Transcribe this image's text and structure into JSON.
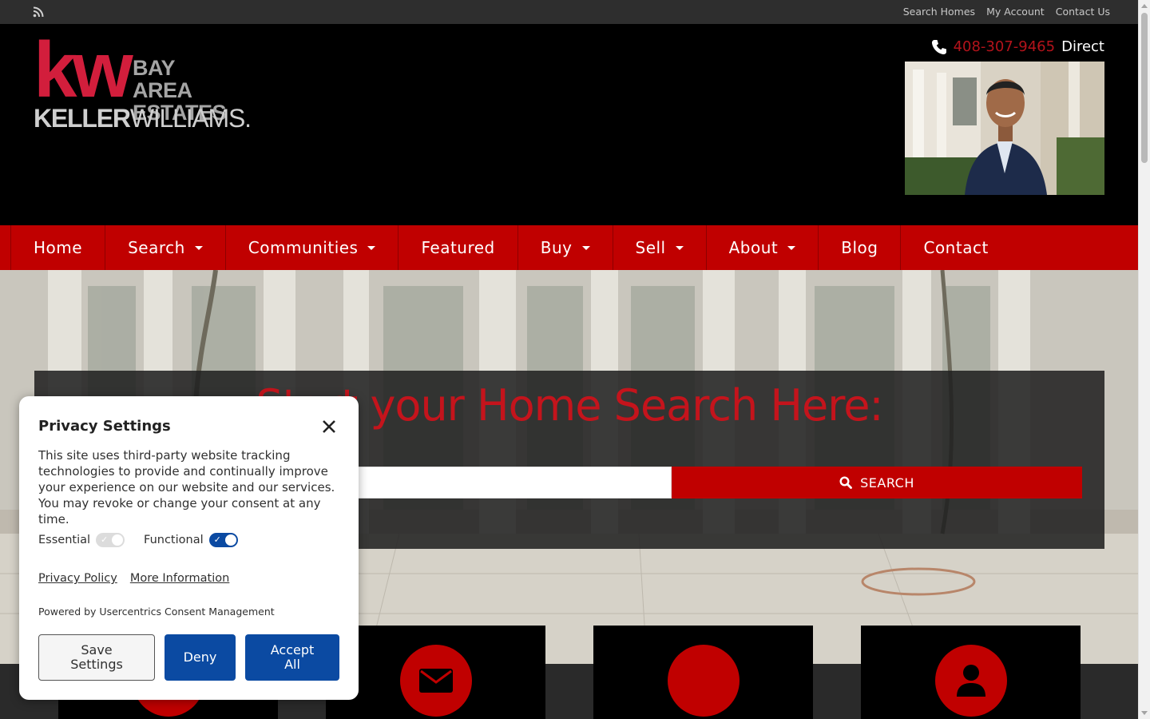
{
  "topbar": {
    "rss_icon": "rss-icon",
    "links": [
      "Search Homes",
      "My Account",
      "Contact Us"
    ]
  },
  "header": {
    "logo": {
      "kw": "kw",
      "line1": "BAY AREA",
      "line2": "ESTATES",
      "brand_bold": "KELLER",
      "brand_light": "WILLIAMS."
    },
    "phone": {
      "number": "408-307-9465",
      "label": "Direct"
    }
  },
  "nav": {
    "items": [
      {
        "label": "Home"
      },
      {
        "label": "Search"
      },
      {
        "label": "Communities"
      },
      {
        "label": "Featured"
      },
      {
        "label": "Buy"
      },
      {
        "label": "Sell"
      },
      {
        "label": "About"
      },
      {
        "label": "Blog"
      },
      {
        "label": "Contact"
      }
    ]
  },
  "hero": {
    "title": "Start your Home Search Here:",
    "search_value": "",
    "search_button": "SEARCH"
  },
  "privacy": {
    "title": "Privacy Settings",
    "description": "This site uses third-party website tracking technologies to provide and continually improve your experience on our website and our services. You may revoke or change your consent at any time.",
    "essential_label": "Essential",
    "functional_label": "Functional",
    "privacy_policy": "Privacy Policy",
    "more_info": "More Information",
    "powered_by": "Powered by Usercentrics Consent Management",
    "save_settings": "Save Settings",
    "deny": "Deny",
    "accept_all": "Accept All"
  },
  "colors": {
    "brand_red": "#c00000",
    "kw_red": "#d21e3c",
    "consent_blue": "#0b4aa2"
  }
}
